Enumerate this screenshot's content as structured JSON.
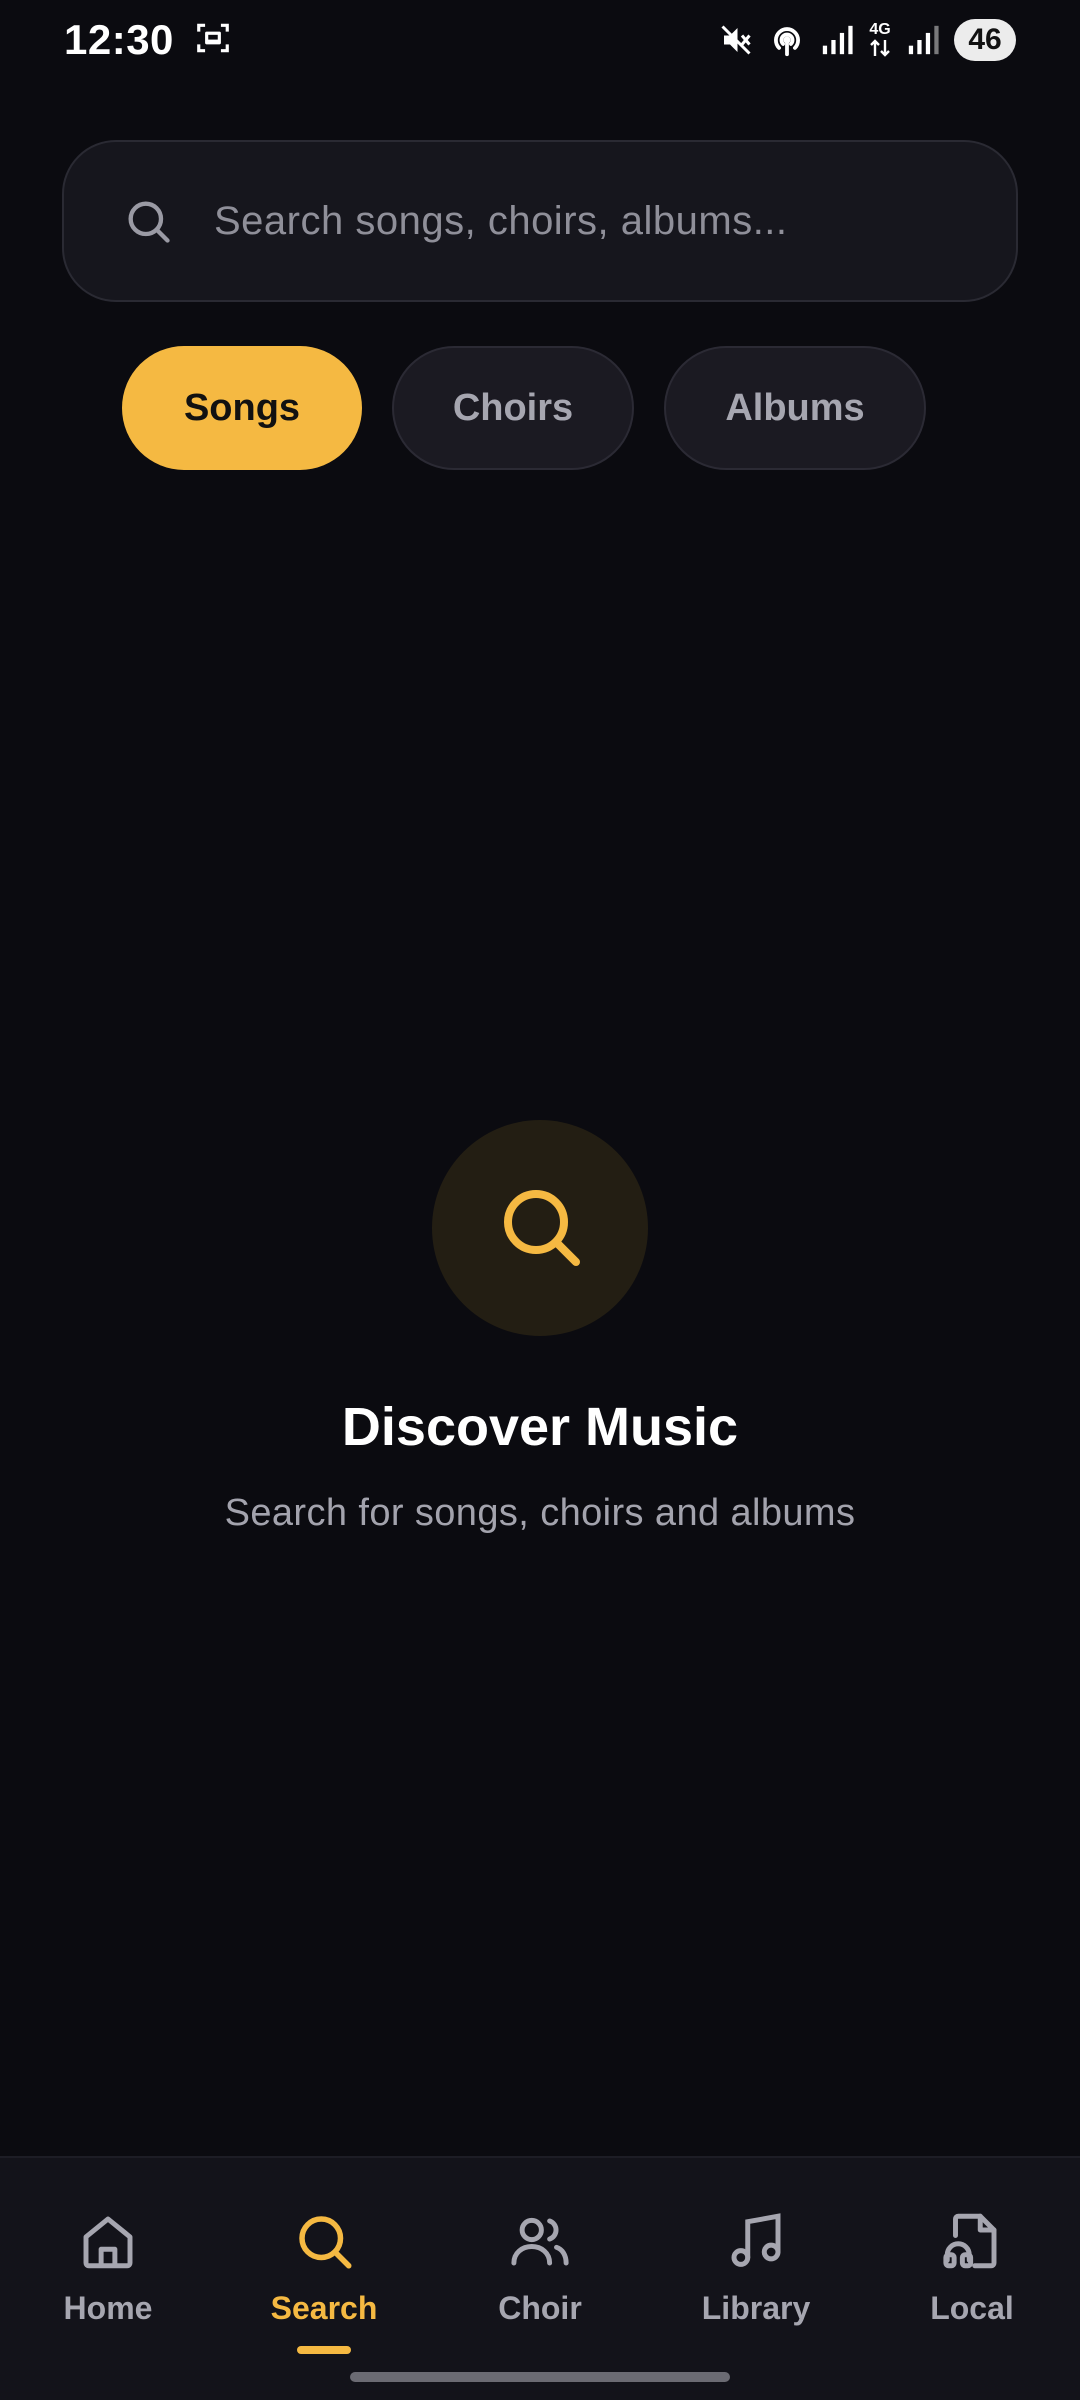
{
  "status_bar": {
    "time": "12:30",
    "battery": "46",
    "network_label": "4G",
    "icons": [
      "screenshot-icon",
      "mute-icon",
      "hotspot-icon",
      "signal-icon",
      "signal-icon"
    ]
  },
  "search": {
    "placeholder": "Search songs, choirs, albums...",
    "value": "",
    "icon": "search-icon"
  },
  "filters": {
    "selected": "Songs",
    "items": [
      {
        "label": "Songs",
        "active": true
      },
      {
        "label": "Choirs",
        "active": false
      },
      {
        "label": "Albums",
        "active": false
      }
    ]
  },
  "empty_state": {
    "icon": "search-icon",
    "title": "Discover Music",
    "subtitle": "Search for songs, choirs and albums"
  },
  "bottom_nav": {
    "active": "Search",
    "items": [
      {
        "label": "Home",
        "icon": "home-icon"
      },
      {
        "label": "Search",
        "icon": "search-icon"
      },
      {
        "label": "Choir",
        "icon": "users-icon"
      },
      {
        "label": "Library",
        "icon": "music-note-icon"
      },
      {
        "label": "Local",
        "icon": "music-file-icon"
      }
    ]
  },
  "colors": {
    "background": "#0b0b10",
    "accent": "#f5b942",
    "surface": "#16161d",
    "muted_text": "#a6a6b0"
  }
}
